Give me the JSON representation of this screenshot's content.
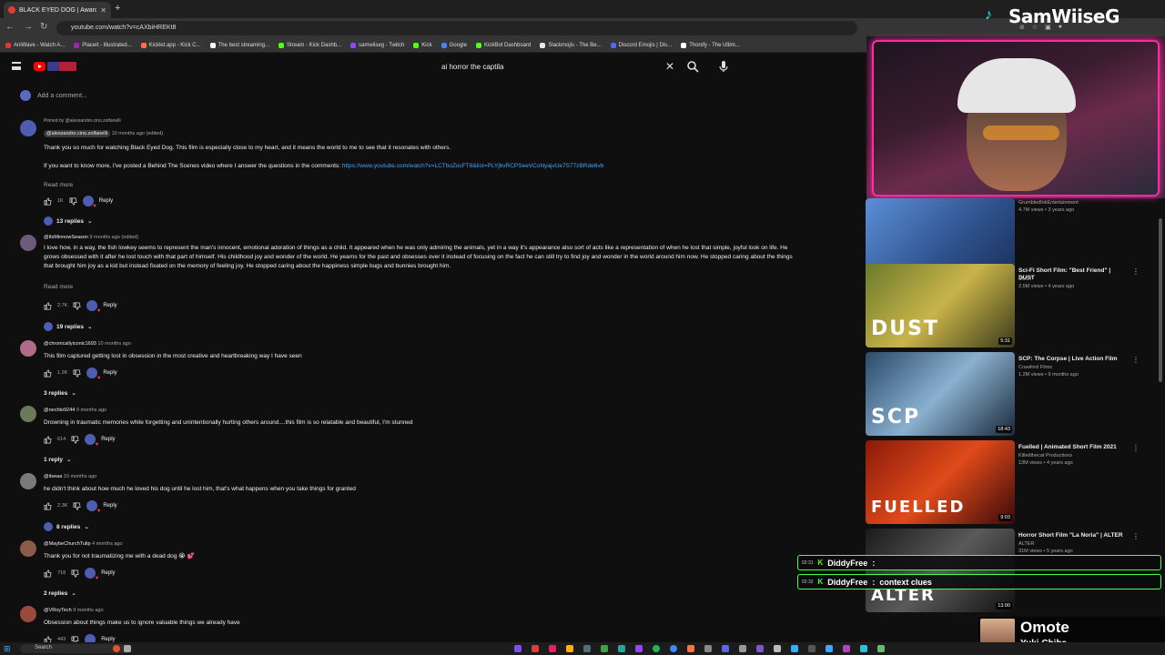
{
  "browser": {
    "tab_title": "BLACK EYED DOG | Award",
    "url": "youtube.com/watch?v=cAXbiHREKt8",
    "bookmarks": [
      {
        "label": "AniWave - Watch A...",
        "color": "#e53935"
      },
      {
        "label": "Placeit - Illustrated...",
        "color": "#9c27b0"
      },
      {
        "label": "Kicklet.app - Kick C...",
        "color": "#ff7043"
      },
      {
        "label": "The best streaming...",
        "color": "#ffffff"
      },
      {
        "label": "Stream - Kick Dashb...",
        "color": "#53fc18"
      },
      {
        "label": "samwiiseg - Twitch",
        "color": "#9146ff"
      },
      {
        "label": "Kick",
        "color": "#53fc18"
      },
      {
        "label": "Google",
        "color": "#4285f4"
      },
      {
        "label": "KickBot Dashboard",
        "color": "#53fc18"
      },
      {
        "label": "Slackmojis - The Be...",
        "color": "#e8e8e8"
      },
      {
        "label": "Discord Emojis | Dis...",
        "color": "#5865f2"
      },
      {
        "label": "Thonify - The Ultim...",
        "color": "#ffffff"
      }
    ]
  },
  "youtube": {
    "search_value": "ai horror the captila",
    "add_comment_placeholder": "Add a comment..."
  },
  "comments": [
    {
      "pinned": "Pinned by @alessandro.cino.zolfanelli",
      "author": "@alessandro.cino.zolfanelli",
      "meta": "10 months ago (edited)",
      "avatar_color": "#4d5db1",
      "text_lines": [
        "Thank you so much for watching Black Eyed Dog. This film is especially close to my heart, and it means the world to me to see that it resonates with others."
      ],
      "text2": "If you want to know more, I've posted a Behind The Scenes video where I answer the questions in the comments: ",
      "link": "https://www.youtube.com/watch?v=LCTboZocFT8&list=PLYjbvRCPSeeVCoNyajvUe7S77zBRde6vb",
      "read_more": "Read more",
      "likes": "1K",
      "reply": "Reply",
      "replies": "13 replies"
    },
    {
      "author": "@ItsMinnowSeason",
      "meta": "9 months ago (edited)",
      "avatar_color": "#6d5b7a",
      "text_lines": [
        "I love how, in a way, the fish lowkey seems to represent the man's innocent, emotional adoration of things as a child. It appeared when he was only admiring the animals, yet in a way it's appearance also sort of acts like a representation of when he lost that simple, joyful look on life. He",
        "grows obsessed with it after he lost touch with that part of himself. His childhood joy and wonder of the world. He yearns for the past and obsesses over it instead of focusing on the fact he can still try to find joy and wonder in the world around him now. He stopped caring about the things",
        "that brought him joy as a kid but instead fixated on the memory of feeling joy. He stopped caring about the happiness simple bugs and bunnies brought him."
      ],
      "read_more": "Read more",
      "likes": "2.7K",
      "reply": "Reply",
      "replies": "19 replies"
    },
    {
      "author": "@chronicallyiconic1693",
      "meta": "10 months ago",
      "avatar_color": "#b26a8a",
      "text_lines": [
        "This film captured getting lost in obsession in the most creative and heartbreaking way I have seen"
      ],
      "likes": "1.2K",
      "reply": "Reply",
      "replies": "3 replies"
    },
    {
      "author": "@nechto9244",
      "meta": "9 months ago",
      "avatar_color": "#6b7a5a",
      "text_lines": [
        "Drowning in traumatic memories while forgetting and unintentionally hurting others around....this film is so relatable and beautiful, I'm stunned"
      ],
      "likes": "614",
      "reply": "Reply",
      "replies": "1 reply"
    },
    {
      "author": "@itseaa",
      "meta": "10 months ago",
      "avatar_color": "#7a7a7a",
      "text_lines": [
        "he didn't think about how much he loved his dog until he lost him, that's what happens when you take things for granted"
      ],
      "likes": "2.3K",
      "reply": "Reply",
      "replies": "8 replies"
    },
    {
      "author": "@MaybeChurchTulip",
      "meta": "4 months ago",
      "avatar_color": "#8a5a4a",
      "text_lines": [
        "Thank you for not traumatizing me with a dead dog 😭 💕"
      ],
      "likes": "718",
      "reply": "Reply",
      "replies": "2 replies"
    },
    {
      "author": "@VRoyTech",
      "meta": "9 months ago",
      "avatar_color": "#9a4a3a",
      "text_lines": [
        "Obsession about things make us to ignore valuable things we already have"
      ],
      "likes": "443",
      "reply": "Reply",
      "replies": ""
    }
  ],
  "related": [
    {
      "title": "",
      "channel": "GrumbledInkEntertainment",
      "meta": "4.7M views • 3 years ago",
      "duration": "7:31",
      "thumb": "linear-gradient(135deg,#5b8fd6,#2d4f8a 60%,#1a2e55)"
    },
    {
      "title": "Sci-Fi Short Film: \"Best Friend\" | DUST",
      "channel": "DUST",
      "meta": "2.5M views • 4 years ago",
      "duration": "5:31",
      "thumb": "linear-gradient(135deg,#6b7a2a,#c9b44a 50%,#3a3a1a)",
      "overlay": "DUST"
    },
    {
      "title": "SCP: The Corpse | Live Action Film",
      "channel": "Crawford Films",
      "meta": "1.2M views • 9 months ago",
      "duration": "18:43",
      "thumb": "linear-gradient(135deg,#2a4a6a,#8ab0d0 50%,#1a2a3a)",
      "overlay": "SCP"
    },
    {
      "title": "Fuelled | Animated Short Film 2021",
      "channel": "Killedthecat Productions",
      "meta": "13M views • 4 years ago",
      "duration": "9:03",
      "thumb": "linear-gradient(135deg,#8a1a0a,#e04a1a 50%,#3a0a0a)",
      "overlay": "FUELLED"
    },
    {
      "title": "Horror Short Film \"La Noria\" | ALTER",
      "channel": "ALTER",
      "meta": "31M views • 5 years ago",
      "duration": "13:00",
      "thumb": "linear-gradient(135deg,#1a1a1a,#5a5a5a 50%,#111)",
      "overlay": "ALTER"
    }
  ],
  "stream": {
    "name": "SamWiiseG",
    "chat": [
      {
        "time": "02:31",
        "user": "DiddyFree",
        "msg": ""
      },
      {
        "time": "02:32",
        "user": "DiddyFree",
        "msg": "context clues"
      }
    ],
    "song": "Omote",
    "artist": "Yuki Chiba"
  },
  "taskbar": {
    "search": "Search"
  }
}
